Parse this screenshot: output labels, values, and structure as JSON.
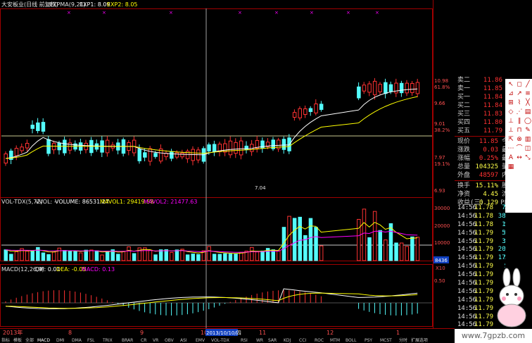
{
  "main_panel": {
    "title": "大安板业(日线 前复权)",
    "indicator": "EXPMA(9,21)",
    "exp1_label": "EXP1: 8.09",
    "exp2_label": "EXP2: 8.05",
    "price_axis": [
      "10.98",
      "61.8%",
      "9.66",
      "9.01",
      "38.2%",
      "7.97",
      "19.1%",
      "6.93"
    ],
    "low_marker": "7.04"
  },
  "volume_panel": {
    "indicator": "VOL-TDX(5,72)",
    "vvol_label": "VVOL: -",
    "volume_label": "VOLUME: 86531.27",
    "mavol1_label": "MAVOL1: 29419.58",
    "mavol2_label": "MAVOL2: 21477.63",
    "axis": [
      "30000",
      "20000",
      "10000"
    ],
    "current_tag": "8436",
    "unit": "X10"
  },
  "macd_panel": {
    "indicator": "MACD(12,26,9)",
    "dif_label": "DIF: 0.01",
    "dea_label": "DEA: -0.05",
    "macd_label": "MACD: 0.13",
    "axis": [
      "0.50"
    ]
  },
  "date_axis": {
    "year": "2013年",
    "months": [
      "8",
      "9",
      "10",
      "11",
      "12",
      "1"
    ],
    "cursor_date": "2013/10/10/四"
  },
  "bottom_tabs": [
    "指标",
    "模板",
    "全部",
    "MACD",
    "DMI",
    "DMA",
    "FSL",
    "TRIX",
    "BRAR",
    "CR",
    "VR",
    "OBV",
    "ASI",
    "EMV",
    "VOL-TDX",
    "RSI",
    "WR",
    "SAR",
    "KDJ",
    "CCI",
    "ROC",
    "MTM",
    "BOLL",
    "PSY",
    "MCST",
    "分时",
    "扩展选项"
  ],
  "quote": {
    "asks": [
      {
        "label": "卖一",
        "price": "11.85"
      },
      {
        "label": "卖二",
        "price": "11.86"
      }
    ],
    "bids": [
      {
        "label": "买一",
        "price": "11.84"
      },
      {
        "label": "买二",
        "price": "11.84"
      },
      {
        "label": "买三",
        "price": "11.83"
      },
      {
        "label": "买四",
        "price": "11.80"
      },
      {
        "label": "买五",
        "price": "11.79"
      }
    ],
    "stats": [
      {
        "label": "现价",
        "value": "11.85",
        "suffix": "今"
      },
      {
        "label": "涨跌",
        "value": "0.03",
        "suffix": "最"
      },
      {
        "label": "涨幅",
        "value": "0.25%",
        "suffix": "最"
      },
      {
        "label": "总量",
        "value": "104325",
        "suffix": "量"
      },
      {
        "label": "外盘",
        "value": "48597",
        "suffix": "内"
      },
      {
        "label": "换手",
        "value": "15.11%",
        "suffix": "股"
      },
      {
        "label": "净资",
        "value": "4.45",
        "suffix": "流"
      },
      {
        "label": "收益(三)",
        "value": "0.129",
        "suffix": "PE"
      }
    ]
  },
  "ticks": [
    {
      "time": "14:56",
      "price": "11.78",
      "qty": "73",
      "side": "S"
    },
    {
      "time": "14:56",
      "price": "11.78",
      "qty": "389",
      "side": "S"
    },
    {
      "time": "14:56",
      "price": "11.78",
      "qty": "12",
      "side": "S"
    },
    {
      "time": "14:56",
      "price": "11.79",
      "qty": "50",
      "side": "S"
    },
    {
      "time": "14:56",
      "price": "11.79",
      "qty": "34",
      "side": "S"
    },
    {
      "time": "14:56",
      "price": "11.79",
      "qty": "205",
      "side": "S"
    },
    {
      "time": "14:56",
      "price": "11.79",
      "qty": "173",
      "side": "S"
    },
    {
      "time": "14:56",
      "price": "11.79",
      "qty": "1",
      "side": "S"
    },
    {
      "time": "14:56",
      "price": "11.79",
      "qty": "3",
      "side": "S"
    },
    {
      "time": "14:56",
      "price": "11.79",
      "qty": "5",
      "side": "S"
    },
    {
      "time": "14:56",
      "price": "11.79",
      "qty": "2",
      "side": "S"
    },
    {
      "time": "14:56",
      "price": "11.79",
      "qty": "17",
      "side": "S"
    },
    {
      "time": "14:56",
      "price": "11.79",
      "qty": "6",
      "side": "S"
    },
    {
      "time": "14:56",
      "price": "11.79",
      "qty": "10",
      "side": "S"
    },
    {
      "time": "14:56",
      "price": "11.79",
      "qty": "2",
      "side": "S"
    },
    {
      "time": "14:56",
      "price": "11.79",
      "qty": "1",
      "side": "S"
    }
  ],
  "watermark": "www.7gpzb.com",
  "colors": {
    "up": "#ff3232",
    "down": "#54fcfc",
    "line_white": "#ffffff",
    "line_yellow": "#ffff00",
    "line_magenta": "#ff00ff",
    "axis": "#a00000",
    "grid_label": "#ff5050"
  }
}
